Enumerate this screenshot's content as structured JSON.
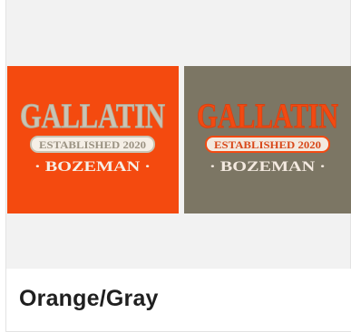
{
  "product": {
    "variant_title": "Orange/Gray"
  },
  "swatches": [
    {
      "name": "orange",
      "background": "#f44a0f",
      "logo": {
        "main": "GALLATIN",
        "sub": "ESTABLISHED 2020",
        "city": "· BOZEMAN ·"
      },
      "text_color": "#c9c4b4",
      "band_color": "#f5efe6",
      "band_text_color": "#9a9282"
    },
    {
      "name": "gray",
      "background": "#7c7664",
      "logo": {
        "main": "GALLATIN",
        "sub": "ESTABLISHED 2020",
        "city": "· BOZEMAN ·"
      },
      "text_color": "#f24a12",
      "band_color": "#f3e9df",
      "band_text_color": "#d8481a"
    }
  ]
}
